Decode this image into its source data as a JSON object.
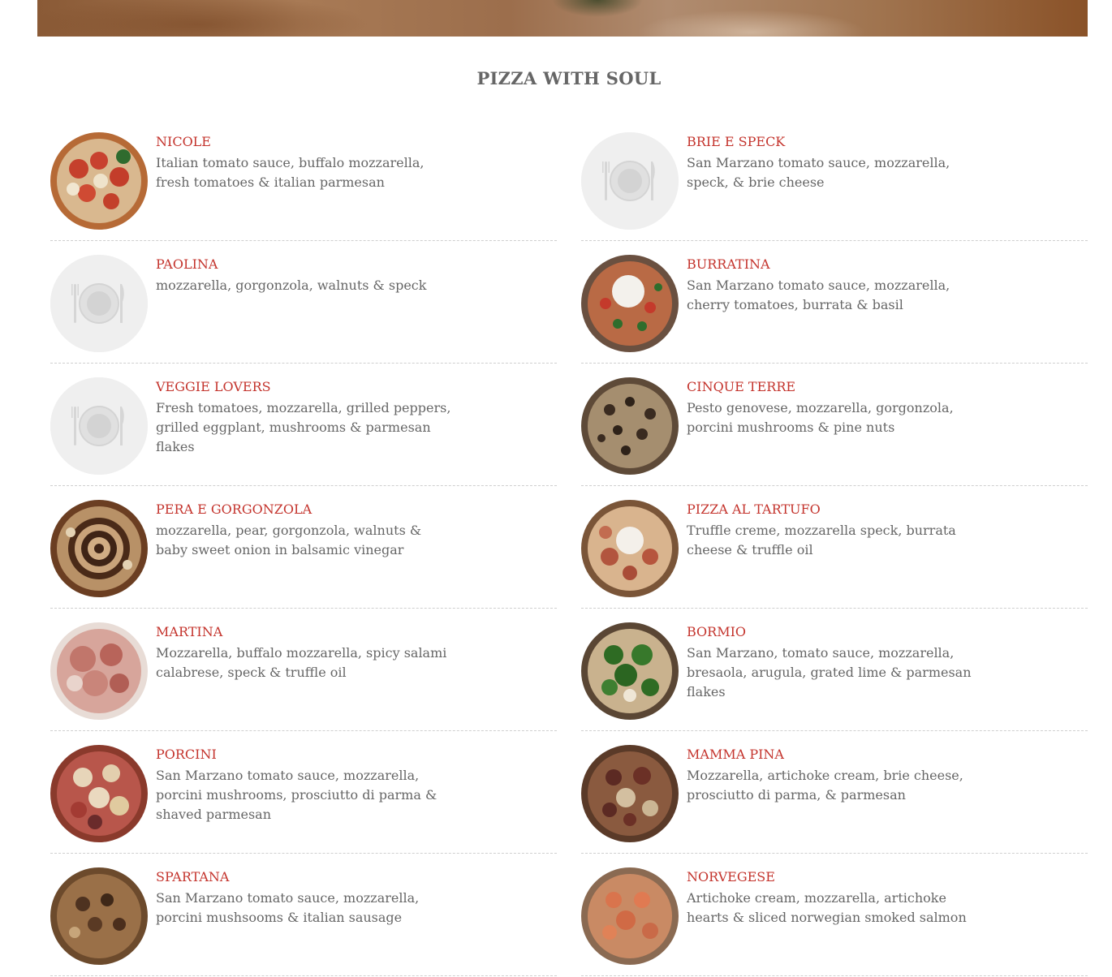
{
  "section": {
    "title": "PIZZA WITH SOUL"
  },
  "left_items": [
    {
      "name": "NICOLE",
      "description": "Italian tomato sauce, buffalo mozzarella, fresh tomatoes & italian parmesan",
      "image": "pizza-margherita"
    },
    {
      "name": "PAOLINA",
      "description": "mozzarella, gorgonzola, walnuts & speck",
      "image": "placeholder"
    },
    {
      "name": "VEGGIE LOVERS",
      "description": "Fresh tomatoes, mozzarella, grilled peppers, grilled eggplant, mushrooms & parmesan flakes",
      "image": "placeholder"
    },
    {
      "name": "PERA E GORGONZOLA",
      "description": "mozzarella, pear, gorgonzola, walnuts & baby sweet onion in balsamic vinegar",
      "image": "pizza-balsamic"
    },
    {
      "name": "MARTINA",
      "description": "Mozzarella, buffalo mozzarella, spicy salami calabrese, speck & truffle oil",
      "image": "pizza-prosciutto"
    },
    {
      "name": "PORCINI",
      "description": "San Marzano tomato sauce, mozzarella, porcini mushrooms, prosciutto di parma & shaved parmesan",
      "image": "pizza-porcini"
    },
    {
      "name": "SPARTANA",
      "description": "San Marzano tomato sauce, mozzarella, porcini mushsooms & italian sausage",
      "image": "pizza-sausage"
    }
  ],
  "right_items": [
    {
      "name": "BRIE E SPECK",
      "description": "San Marzano tomato sauce, mozzarella, speck, & brie cheese",
      "image": "placeholder"
    },
    {
      "name": "BURRATINA",
      "description": "San Marzano tomato sauce, mozzarella, cherry tomatoes, burrata & basil",
      "image": "pizza-burrata"
    },
    {
      "name": "CINQUE TERRE",
      "description": "Pesto genovese, mozzarella, gorgonzola, porcini mushrooms & pine nuts",
      "image": "pizza-mushroom"
    },
    {
      "name": "PIZZA AL TARTUFO",
      "description": "Truffle creme, mozzarella speck, burrata cheese & truffle oil",
      "image": "pizza-truffle"
    },
    {
      "name": "BORMIO",
      "description": "San Marzano, tomato sauce, mozzarella, bresaola, arugula, grated lime & parmesan flakes",
      "image": "pizza-arugula"
    },
    {
      "name": "MAMMA PINA",
      "description": "Mozzarella, artichoke cream, brie cheese, prosciutto di parma, & parmesan",
      "image": "pizza-artichoke"
    },
    {
      "name": "NORVEGESE",
      "description": "Artichoke cream, mozzarella, artichoke hearts & sliced norwegian smoked salmon",
      "image": "pizza-salmon"
    }
  ]
}
